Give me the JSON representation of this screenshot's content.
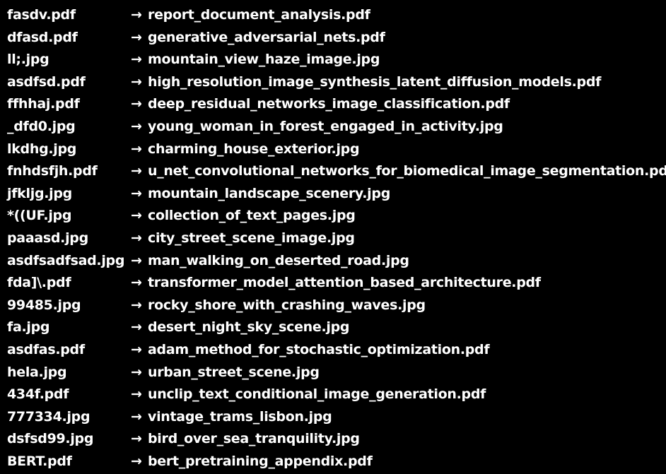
{
  "terminal": {
    "arrow": "→",
    "renames": [
      {
        "old": "fasdv.pdf",
        "new": "report_document_analysis.pdf"
      },
      {
        "old": "dfasd.pdf",
        "new": "generative_adversarial_nets.pdf"
      },
      {
        "old": "ll;.jpg",
        "new": "mountain_view_haze_image.jpg"
      },
      {
        "old": "asdfsd.pdf",
        "new": "high_resolution_image_synthesis_latent_diffusion_models.pdf"
      },
      {
        "old": "ffhhaj.pdf",
        "new": "deep_residual_networks_image_classification.pdf"
      },
      {
        "old": "_dfd0.jpg",
        "new": "young_woman_in_forest_engaged_in_activity.jpg"
      },
      {
        "old": "lkdhg.jpg",
        "new": "charming_house_exterior.jpg"
      },
      {
        "old": "fnhdsfjh.pdf",
        "new": "u_net_convolutional_networks_for_biomedical_image_segmentation.pdf"
      },
      {
        "old": "jfkljg.jpg",
        "new": "mountain_landscape_scenery.jpg"
      },
      {
        "old": "*((UF.jpg",
        "new": "collection_of_text_pages.jpg"
      },
      {
        "old": "paaasd.jpg",
        "new": "city_street_scene_image.jpg"
      },
      {
        "old": "asdfsadfsad.jpg",
        "new": "man_walking_on_deserted_road.jpg"
      },
      {
        "old": "fda]\\.pdf",
        "new": "transformer_model_attention_based_architecture.pdf"
      },
      {
        "old": "99485.jpg",
        "new": "rocky_shore_with_crashing_waves.jpg"
      },
      {
        "old": "fa.jpg",
        "new": "desert_night_sky_scene.jpg"
      },
      {
        "old": "asdfas.pdf",
        "new": "adam_method_for_stochastic_optimization.pdf"
      },
      {
        "old": "hela.jpg",
        "new": "urban_street_scene.jpg"
      },
      {
        "old": "434f.pdf",
        "new": "unclip_text_conditional_image_generation.pdf"
      },
      {
        "old": "777334.jpg",
        "new": "vintage_trams_lisbon.jpg"
      },
      {
        "old": "dsfsd99.jpg",
        "new": "bird_over_sea_tranquility.jpg"
      },
      {
        "old": "BERT.pdf",
        "new": "bert_pretraining_appendix.pdf"
      }
    ]
  }
}
